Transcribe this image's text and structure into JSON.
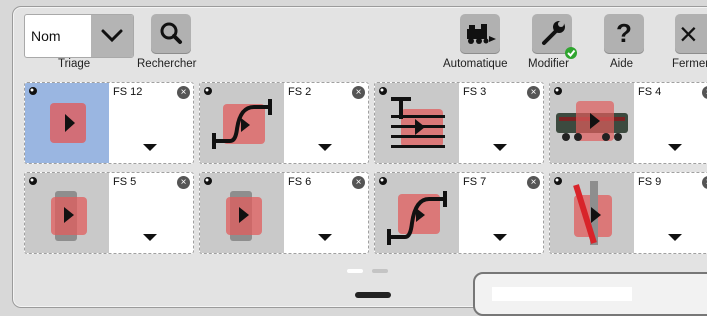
{
  "toolbar": {
    "sort": {
      "value": "Nom",
      "label": "Triage"
    },
    "search_label": "Rechercher",
    "automatic_label": "Automatique",
    "edit_label": "Modifier",
    "help_label": "Aide",
    "help_glyph": "?",
    "close_label": "Fermer",
    "close_glyph": "×"
  },
  "tiles": [
    {
      "name": "FS 12",
      "icon": "signal-icon",
      "active": true
    },
    {
      "name": "FS 2",
      "icon": "curved-track-icon",
      "active": false
    },
    {
      "name": "FS 3",
      "icon": "buffer-stop-icon",
      "active": false
    },
    {
      "name": "FS 4",
      "icon": "locomotive-icon",
      "active": false
    },
    {
      "name": "FS 5",
      "icon": "signal-icon",
      "active": false
    },
    {
      "name": "FS 6",
      "icon": "signal-icon",
      "active": false
    },
    {
      "name": "FS 7",
      "icon": "curved-track-icon",
      "active": false
    },
    {
      "name": "FS 9",
      "icon": "turnout-icon",
      "active": false
    }
  ],
  "tile_close_glyph": "×",
  "colors": {
    "active_tile": "#9ab6e1",
    "icon_red": "#e05c5c",
    "edit_check": "#2fa52f"
  }
}
